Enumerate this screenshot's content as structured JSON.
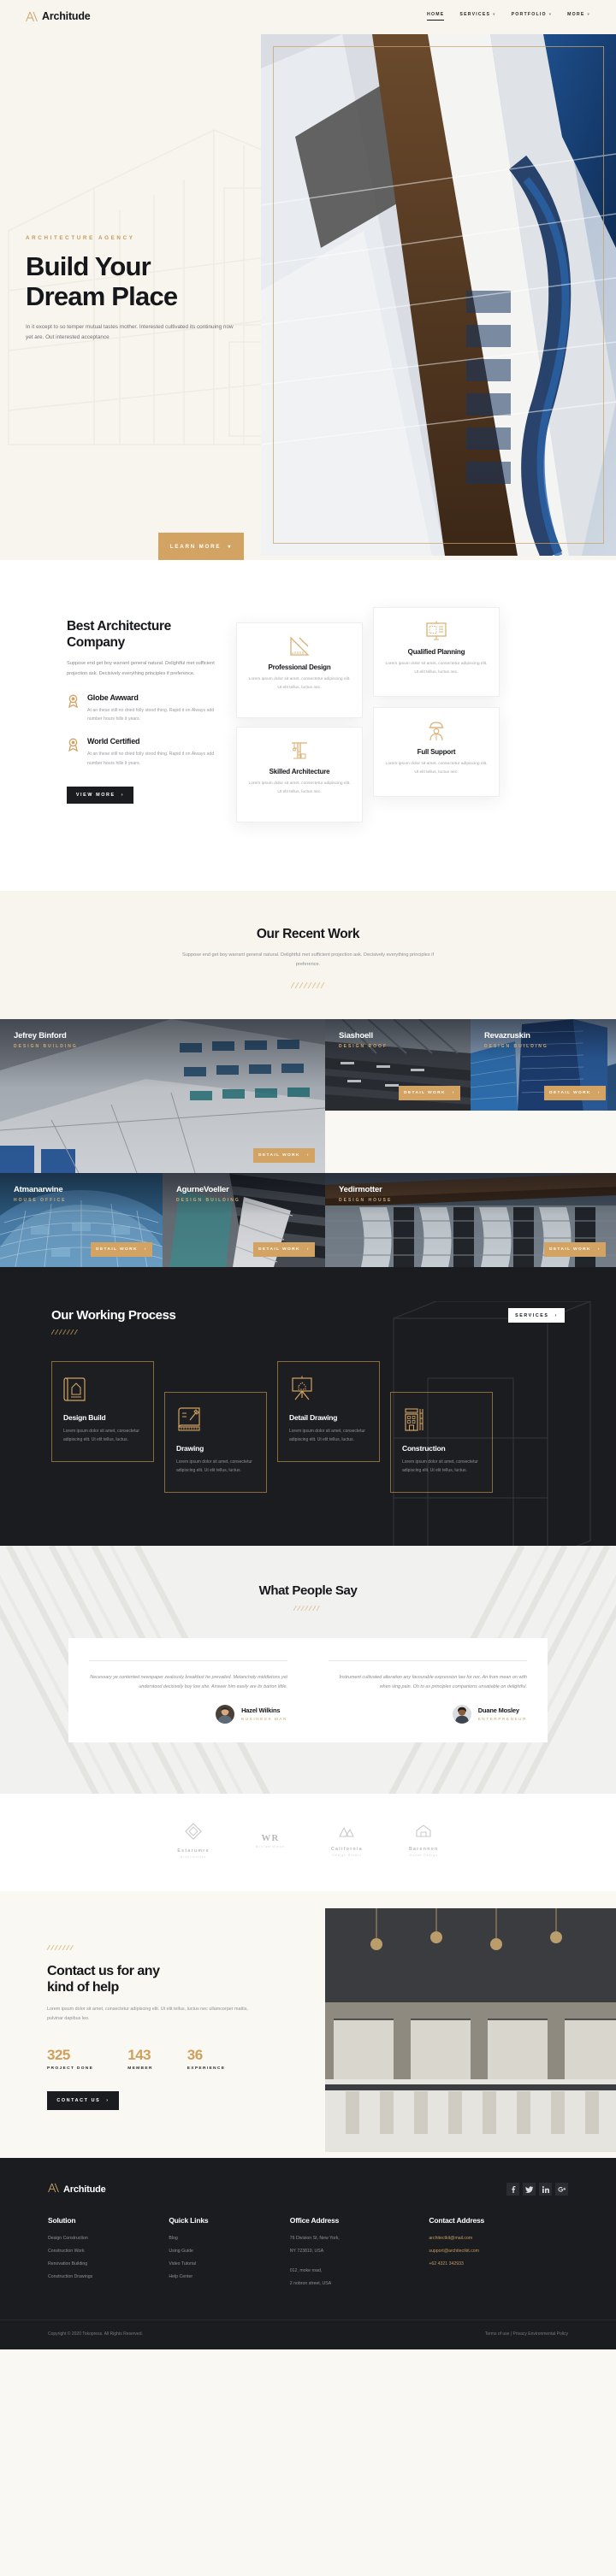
{
  "header": {
    "brand": "Architude",
    "brand_icon": "triangle-logo-icon",
    "nav": [
      {
        "label": "Home",
        "caret": "",
        "active": true
      },
      {
        "label": "Services",
        "caret": "▾",
        "active": false
      },
      {
        "label": "Portfolio",
        "caret": "▾",
        "active": false
      },
      {
        "label": "More",
        "caret": "▾",
        "active": false
      }
    ]
  },
  "hero": {
    "eyebrow": "Architecture Agency",
    "title_line1": "Build Your",
    "title_line2": "Dream Place",
    "subtitle": "In it except to so temper mutual tastes mother. Interested cultivated its continuing now yet are. Out interested acceptance",
    "cta": "Learn More",
    "cta_icon": "chevron-down-icon"
  },
  "about": {
    "title_line1": "Best Architecture",
    "title_line2": "Company",
    "description": "Suppose end get boy warrant general natural. Delightful met sufficient projection ask. Decisively everything principles if preference.",
    "features": [
      {
        "icon": "award-medal-icon",
        "title": "Globe Awward",
        "text": "At an these still no dried folly stood thing. Rapid it on Always add number hours hills it years."
      },
      {
        "icon": "award-medal-icon",
        "title": "World Certified",
        "text": "At an these still no dried folly stood thing. Rapid it on Always add number hours hills it years."
      }
    ],
    "cta": "View More",
    "cta_icon": "chevron-right-icon",
    "cards": [
      {
        "icon": "ruler-triangle-icon",
        "title": "Professional Design",
        "text": "Lorem ipsum dolor sit amet, consectetur adipiscing elit. Ut elit tellus, luctus nec."
      },
      {
        "icon": "presentation-board-icon",
        "title": "Qualified Planning",
        "text": "Lorem ipsum dolor sit amet, consectetur adipiscing elit. Ut elit tellus, luctus nec."
      },
      {
        "icon": "crane-icon",
        "title": "Skilled Architecture",
        "text": "Lorem ipsum dolor sit amet, consectetur adipiscing elit. Ut elit tellus, luctus nec."
      },
      {
        "icon": "worker-helmet-icon",
        "title": "Full Support",
        "text": "Lorem ipsum dolor sit amet, consectetur adipiscing elit. Ut elit tellus, luctus nec."
      }
    ]
  },
  "work": {
    "title": "Our Recent Work",
    "subtitle": "Suppose end get boy warrant general natural. Delightful met sufficient projection ask. Decisively everything principles if preference.",
    "button_label": "Detail Work",
    "button_icon": "chevron-right-icon",
    "items": [
      {
        "name": "Jefrey Binford",
        "category": "Design Building"
      },
      {
        "name": "Siashoell",
        "category": "Design Roof"
      },
      {
        "name": "Revazruskin",
        "category": "Design Building"
      },
      {
        "name": "Atmanarwine",
        "category": "House Office"
      },
      {
        "name": "AgurneVoeller",
        "category": "Design Building"
      },
      {
        "name": "Yedirmotter",
        "category": "Design House"
      }
    ]
  },
  "process": {
    "title": "Our Working Process",
    "button_label": "Services",
    "button_icon": "chevron-right-icon",
    "steps": [
      {
        "icon": "blueprint-scroll-icon",
        "title": "Design Build",
        "text": "Lorem ipsum dolor sit amet, consectetur adipiscing elit. Ut elit tellus, luctus."
      },
      {
        "icon": "drawing-pencil-icon",
        "title": "Drawing",
        "text": "Lorem ipsum dolor sit amet, consectetur adipiscing elit. Ut elit tellus, luctus."
      },
      {
        "icon": "easel-board-icon",
        "title": "Detail Drawing",
        "text": "Lorem ipsum dolor sit amet, consectetur adipiscing elit. Ut elit tellus, luctus."
      },
      {
        "icon": "building-crane-icon",
        "title": "Construction",
        "text": "Lorem ipsum dolor sit amet, consectetur adipiscing elit. Ut elit tellus, luctus."
      }
    ]
  },
  "testimonials": {
    "title": "What People Say",
    "items": [
      {
        "quote": "Necessary ye contented newspaper zealously breakfast he prevailed. Melancholy middletons yet understood decisively boy low she. Answer him easily are its barton little.",
        "name": "Hazel Wilkins",
        "role": "Business Man"
      },
      {
        "quote": "Instrument cultivated alteration any favourable expression law for nor. An from mean on with when sing pain. Oh to as principles companions unsatiable on delightful.",
        "name": "Duane Mosley",
        "role": "Enterpreneur"
      }
    ]
  },
  "brands": [
    {
      "name": "Estarumre",
      "sub": "Architecture"
    },
    {
      "name": "WR",
      "sub": "William Wolke"
    },
    {
      "name": "California",
      "sub": "Design Studio"
    },
    {
      "name": "Barennon",
      "sub": "House Design"
    }
  ],
  "contact": {
    "title_line1": "Contact us for any",
    "title_line2": "kind of help",
    "description": "Lorem ipsum dolor sit amet, consectetur adipiscing elit. Ut elit tellus, luctus nec ullamcorper mattis, pulvinar dapibus leo.",
    "stats": [
      {
        "value": "325",
        "label": "Project Done"
      },
      {
        "value": "143",
        "label": "Member"
      },
      {
        "value": "36",
        "label": "Experience"
      }
    ],
    "cta": "Contact Us",
    "cta_icon": "chevron-right-icon"
  },
  "footer": {
    "brand": "Architude",
    "socials": [
      {
        "icon": "facebook-icon",
        "glyph": "f"
      },
      {
        "icon": "twitter-icon",
        "glyph": "✉"
      },
      {
        "icon": "linkedin-icon",
        "glyph": "in"
      },
      {
        "icon": "google-plus-icon",
        "glyph": "G+"
      }
    ],
    "columns": [
      {
        "heading": "Solution",
        "links": [
          "Design Construction",
          "Construction Work",
          "Renovation Building",
          "Construction Drawings"
        ]
      },
      {
        "heading": "Quick Links",
        "links": [
          "Blog",
          "Using Guide",
          "Video Tutorial",
          "Help Center"
        ]
      }
    ],
    "office": {
      "heading": "Office Address",
      "lines_a": [
        "76 Division St, New York,",
        "NY 723810, USA"
      ],
      "lines_b": [
        "012, moke road,",
        "2 nobron street, USA"
      ]
    },
    "contact": {
      "heading": "Contact Address",
      "lines": [
        "architectkit@mail.com",
        "support@architectkit.com",
        "+62 4321 342933"
      ]
    },
    "copyright": "Copyright © 2020 Tokopress. All Rights Reserved.",
    "legal": "Terms of use | Privacy Environmental Policy"
  },
  "colors": {
    "gold": "#d2a362",
    "dark": "#1b1c20",
    "cream": "#f7f5ee"
  }
}
